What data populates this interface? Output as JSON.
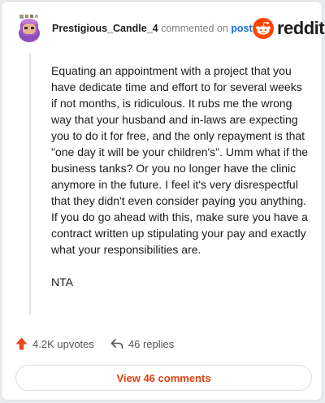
{
  "comment": {
    "username": "Prestigious_Candle_4",
    "commented_text": "commented on",
    "post_link": "post",
    "brand": "reddit",
    "paragraphs": [
      "Equating an appointment with a project that you have dedicate time and effort to for several weeks if not months, is ridiculous. It rubs me the wrong way that your husband and in-laws are expecting you to do it for free, and the only repayment is that \"one day it will be your children's\". Umm what if the business tanks? Or you no longer have the clinic anymore in the future. I feel it's very disrespectful that they didn't even consider paying you anything. If you do go ahead with this, make sure you have a contract written up stipulating your pay and exactly what your responsibilities are.",
      "NTA"
    ],
    "upvotes": "4.2K upvotes",
    "replies": "46 replies",
    "view_comments": "View 46 comments"
  },
  "colors": {
    "accent": "#ff4500",
    "link": "#1b6ed9",
    "button_text": "#e0420f",
    "card_bg": "#ffffff",
    "page_bg": "#e9eaec"
  },
  "icons": {
    "avatar": "snoo-avatar-purple-hair",
    "brand": "reddit-snoo-icon",
    "upvote": "upvote-arrow-icon",
    "reply": "reply-arrow-icon"
  }
}
